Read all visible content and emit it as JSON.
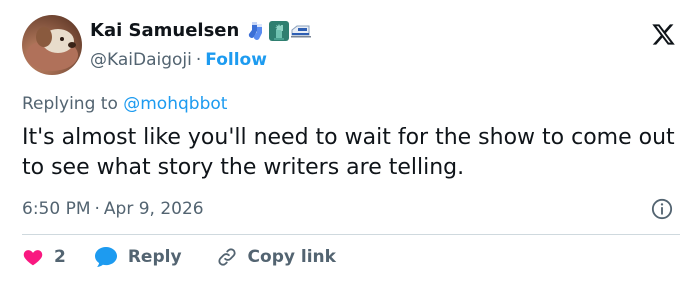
{
  "user": {
    "display_name": "Kai Samuelsen",
    "handle": "@KaiDaigoji",
    "follow_label": "Follow",
    "name_emojis": [
      "socks-emoji",
      "statue-of-liberty-emoji",
      "train-emoji"
    ]
  },
  "replying": {
    "prefix": "Replying to",
    "mention": "@mohqbbot"
  },
  "tweet": {
    "text": "It's almost like you'll need to wait for the show to come out to see what story the writers are telling."
  },
  "meta": {
    "time": "6:50 PM",
    "separator": "·",
    "date": "Apr 9, 2026"
  },
  "actions": {
    "like_count": "2",
    "reply_label": "Reply",
    "copy_label": "Copy link"
  },
  "colors": {
    "accent": "#1d9bf0",
    "like": "#f91880",
    "text": "#0f1419",
    "muted": "#536471",
    "divider": "#cfd9de"
  }
}
